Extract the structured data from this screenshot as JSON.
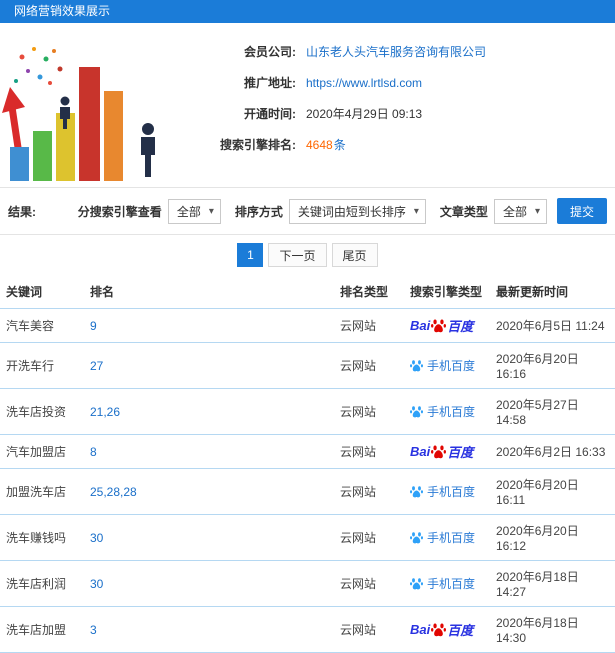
{
  "header": {
    "title": "网络营销效果展示"
  },
  "info": {
    "company_label": "会员公司:",
    "company_value": "山东老人头汽车服务咨询有限公司",
    "url_label": "推广地址:",
    "url_value": "https://www.lrtlsd.com",
    "open_label": "开通时间:",
    "open_value": "2020年4月29日 09:13",
    "rank_label": "搜索引擎排名:",
    "rank_number": "4648",
    "rank_unit": "条"
  },
  "filters": {
    "result_label": "结果:",
    "engine_label": "分搜索引擎查看",
    "engine_value": "全部",
    "sort_label": "排序方式",
    "sort_value": "关键词由短到长排序",
    "type_label": "文章类型",
    "type_value": "全部",
    "submit_label": "提交"
  },
  "pagination": {
    "page": "1",
    "next": "下一页",
    "last": "尾页"
  },
  "table": {
    "headers": [
      "关键词",
      "排名",
      "排名类型",
      "搜索引擎类型",
      "最新更新时间"
    ],
    "rows": [
      {
        "keyword": "汽车美容",
        "rank": "9",
        "rank_type": "云网站",
        "engine": "baidu_pc",
        "updated": "2020年6月5日 11:24"
      },
      {
        "keyword": "开洗车行",
        "rank": "27",
        "rank_type": "云网站",
        "engine": "baidu_mobile",
        "updated": "2020年6月20日 16:16"
      },
      {
        "keyword": "洗车店投资",
        "rank": "21,26",
        "rank_type": "云网站",
        "engine": "baidu_mobile",
        "updated": "2020年5月27日 14:58"
      },
      {
        "keyword": "汽车加盟店",
        "rank": "8",
        "rank_type": "云网站",
        "engine": "baidu_pc",
        "updated": "2020年6月2日 16:33"
      },
      {
        "keyword": "加盟洗车店",
        "rank": "25,28,28",
        "rank_type": "云网站",
        "engine": "baidu_mobile",
        "updated": "2020年6月20日 16:11"
      },
      {
        "keyword": "洗车赚钱吗",
        "rank": "30",
        "rank_type": "云网站",
        "engine": "baidu_mobile",
        "updated": "2020年6月20日 16:12"
      },
      {
        "keyword": "洗车店利润",
        "rank": "30",
        "rank_type": "云网站",
        "engine": "baidu_mobile",
        "updated": "2020年6月18日 14:27"
      },
      {
        "keyword": "洗车店加盟",
        "rank": "3",
        "rank_type": "云网站",
        "engine": "baidu_pc",
        "updated": "2020年6月18日 14:30"
      }
    ]
  },
  "engines": {
    "baidu_pc": {
      "text_left": "Bai",
      "text_right": "百度"
    },
    "baidu_mobile": {
      "label": "手机百度"
    }
  },
  "colors": {
    "accent_blue": "#1b7cd8",
    "link_blue": "#1a6fc9",
    "highlight_orange": "#ff6600",
    "baidu_blue": "#2932e1",
    "baidu_red": "#e10601",
    "mobile_baidu_blue": "#2ea1f8",
    "table_divider": "#b5d8f2"
  }
}
